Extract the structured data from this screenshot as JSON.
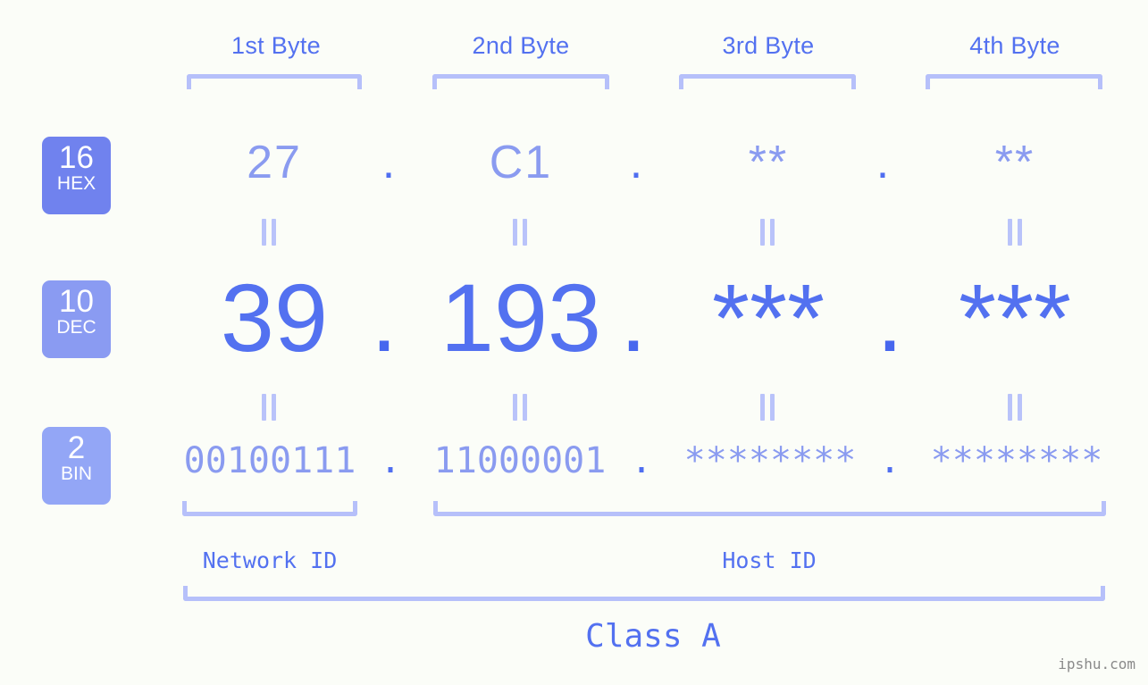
{
  "background_color": "#FBFDF8",
  "accent_color": "#5371F0",
  "muted_accent_color": "#8A9BF0",
  "bracket_color": "#B6C0FA",
  "byte_headers": [
    {
      "label": "1st Byte"
    },
    {
      "label": "2nd Byte"
    },
    {
      "label": "3rd Byte"
    },
    {
      "label": "4th Byte"
    }
  ],
  "rows": [
    {
      "badge_number": "16",
      "badge_system": "HEX",
      "badge_color": "#7082EE",
      "values": [
        "27",
        "C1",
        "**",
        "**"
      ],
      "separators": [
        ".",
        ".",
        "."
      ]
    },
    {
      "badge_number": "10",
      "badge_system": "DEC",
      "badge_color": "#8A9BF2",
      "values": [
        "39",
        "193",
        "***",
        "***"
      ],
      "separators": [
        ".",
        ".",
        "."
      ]
    },
    {
      "badge_number": "2",
      "badge_system": "BIN",
      "badge_color": "#93A6F6",
      "values": [
        "00100111",
        "11000001",
        "********",
        "********"
      ],
      "separators": [
        ".",
        ".",
        "."
      ]
    }
  ],
  "equals_marker": "||",
  "segments": {
    "network_id": "Network ID",
    "host_id": "Host ID"
  },
  "class_label": "Class A",
  "watermark": "ipshu.com"
}
